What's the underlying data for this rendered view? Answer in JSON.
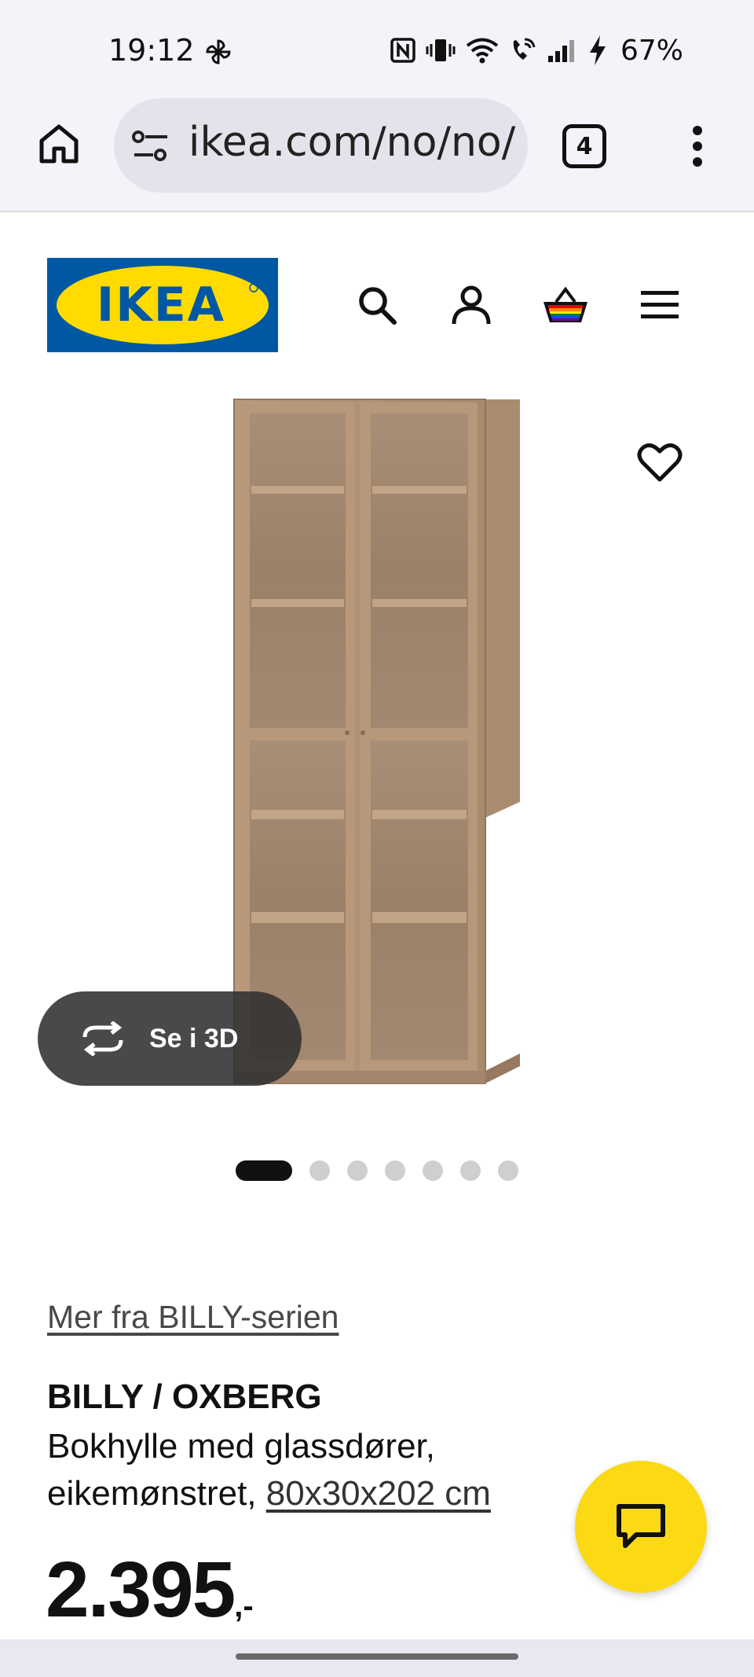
{
  "status_bar": {
    "time": "19:12",
    "battery": "67%",
    "icons": [
      "pinwheel-icon",
      "nfc-icon",
      "vibrate-icon",
      "wifi-icon",
      "wifi-call-icon",
      "signal-icon",
      "charging-icon"
    ]
  },
  "browser": {
    "url": "ikea.com/no/no/p",
    "tab_count": "4",
    "icons": [
      "home-icon",
      "tune-icon",
      "more-vert-icon"
    ]
  },
  "header": {
    "logo_text": "IKEA",
    "icons": [
      "search-icon",
      "account-icon",
      "cart-icon",
      "hamburger-menu-icon"
    ]
  },
  "gallery": {
    "see_3d_label": "Se i 3D",
    "dot_count": 7,
    "active_index": 0
  },
  "product": {
    "series_link": "Mer fra BILLY-serien",
    "name": "BILLY / OXBERG",
    "description": "Bokhylle med glassdører, eikemønstret,",
    "dimensions": "80x30x202 cm",
    "price": "2.395",
    "price_suffix": ",-"
  },
  "colors": {
    "ikea_blue": "#0058a3",
    "ikea_yellow": "#ffdb00",
    "chat_yellow": "#fbd914"
  }
}
